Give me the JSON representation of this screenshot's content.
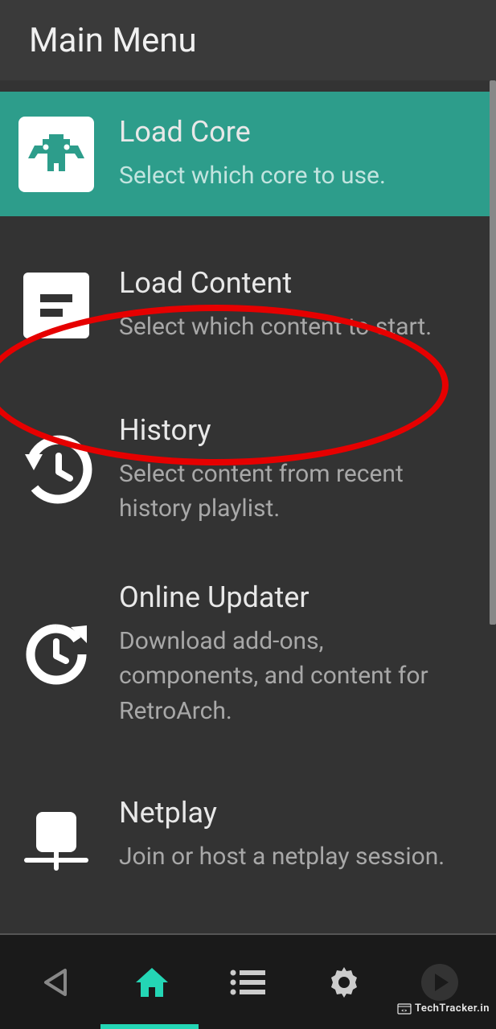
{
  "header": {
    "title": "Main Menu"
  },
  "menu": {
    "items": [
      {
        "title": "Load Core",
        "description": "Select which core to use.",
        "icon": "core-icon",
        "selected": true
      },
      {
        "title": "Load Content",
        "description": "Select which content to start.",
        "icon": "content-icon",
        "highlighted": true
      },
      {
        "title": "History",
        "description": "Select content from recent history playlist.",
        "icon": "history-icon"
      },
      {
        "title": "Online Updater",
        "description": "Download add-ons, components, and content for RetroArch.",
        "icon": "updater-icon"
      },
      {
        "title": "Netplay",
        "description": "Join or host a netplay session.",
        "icon": "netplay-icon"
      }
    ]
  },
  "bottom_nav": {
    "items": [
      {
        "name": "back",
        "active": false
      },
      {
        "name": "home",
        "active": true
      },
      {
        "name": "list",
        "active": false
      },
      {
        "name": "settings",
        "active": false
      },
      {
        "name": "play",
        "active": false
      }
    ]
  },
  "watermark": {
    "text": "TechTracker.in"
  },
  "colors": {
    "accent": "#2d9d8b",
    "active_icon": "#24d6b5",
    "background": "#333333",
    "annotation": "#e60000"
  }
}
